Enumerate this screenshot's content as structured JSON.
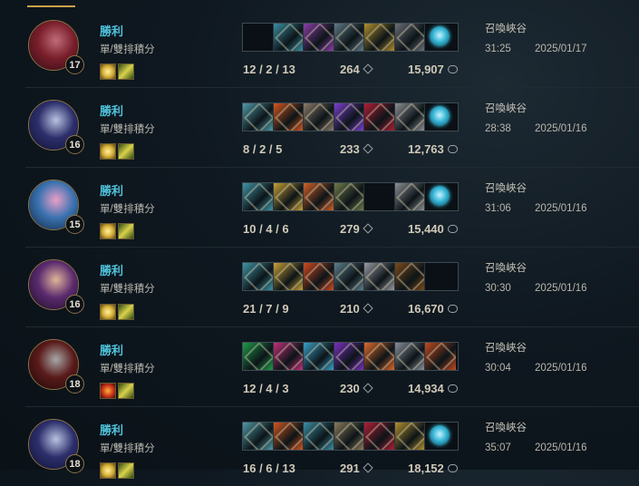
{
  "matches": [
    {
      "champion": "xayah",
      "level": "17",
      "result": "勝利",
      "queue": "單/雙排積分",
      "kda": "12 / 2 / 13",
      "cs": "264",
      "gold": "15,907",
      "map": "召喚峽谷",
      "duration": "31:25",
      "date": "2025/01/17",
      "portrait_colors": [
        "#7a1f2b",
        "#c06b7a",
        "#2a0c14"
      ],
      "spell_icons": [
        "flash-icon",
        "haste-icon"
      ],
      "items": [
        null,
        "#3a8fa3",
        "#8a3fa6",
        "#5f7a86",
        "#b08f2e",
        "#6b6f77",
        "ward-icon"
      ]
    },
    {
      "champion": "aatrox",
      "level": "16",
      "result": "勝利",
      "queue": "單/雙排積分",
      "kda": "8 / 2 / 5",
      "cs": "233",
      "gold": "12,763",
      "map": "召喚峽谷",
      "duration": "28:38",
      "date": "2025/01/16",
      "portrait_colors": [
        "#2c2f6b",
        "#b9c2e0",
        "#0e1030"
      ],
      "spell_icons": [
        "flash-icon",
        "haste-icon"
      ],
      "items": [
        "#4f9aa8",
        "#d0561f",
        "#8a7a6a",
        "#7a3fd0",
        "#b01e36",
        "#8c8f94",
        "ward-icon"
      ]
    },
    {
      "champion": "jinx",
      "level": "15",
      "result": "勝利",
      "queue": "單/雙排積分",
      "kda": "10 / 4 / 6",
      "cs": "279",
      "gold": "15,440",
      "map": "召喚峽谷",
      "duration": "31:06",
      "date": "2025/01/16",
      "portrait_colors": [
        "#3a72b0",
        "#e9a0c8",
        "#10243f"
      ],
      "spell_icons": [
        "flash-icon",
        "haste-icon"
      ],
      "items": [
        "#3f95a6",
        "#c8a036",
        "#d0602a",
        "#6e7a4a",
        null,
        "#8c8f94",
        "ward-icon"
      ]
    },
    {
      "champion": "akali",
      "level": "16",
      "result": "勝利",
      "queue": "單/雙排積分",
      "kda": "21 / 7 / 9",
      "cs": "210",
      "gold": "16,670",
      "map": "召喚峽谷",
      "duration": "30:30",
      "date": "2025/01/16",
      "portrait_colors": [
        "#5a2a6e",
        "#e0b49a",
        "#1a0c22"
      ],
      "spell_icons": [
        "flash-icon",
        "haste-icon"
      ],
      "items": [
        "#3f95a6",
        "#c8a036",
        "#cf4a22",
        "#5e7f8c",
        "#9a9aa3",
        "#7a4a1a",
        null
      ]
    },
    {
      "champion": "mordekaiser",
      "level": "18",
      "result": "勝利",
      "queue": "單/雙排積分",
      "kda": "12 / 4 / 3",
      "cs": "230",
      "gold": "14,934",
      "map": "召喚峽谷",
      "duration": "30:04",
      "date": "2025/01/16",
      "portrait_colors": [
        "#5a1a1a",
        "#a7a7a7",
        "#1a0808"
      ],
      "spell_icons": [
        "ignite-icon",
        "haste-icon"
      ],
      "items": [
        "#1f9a4a",
        "#c0307a",
        "#3aa0c8",
        "#7a30c0",
        "#e06a2a",
        "#8a8f9a",
        "#c04a20"
      ]
    },
    {
      "champion": "aatrox",
      "level": "18",
      "result": "勝利",
      "queue": "單/雙排積分",
      "kda": "16 / 6 / 13",
      "cs": "291",
      "gold": "18,152",
      "map": "召喚峽谷",
      "duration": "35:07",
      "date": "2025/01/16",
      "portrait_colors": [
        "#2c2f6b",
        "#b9c2e0",
        "#0e1030"
      ],
      "spell_icons": [
        "flash-icon",
        "haste-icon"
      ],
      "items": [
        "#4f9aa8",
        "#d0561f",
        "#3a8fa3",
        "#8a7a5a",
        "#b01e36",
        "#b08f2e",
        "ward-icon"
      ]
    }
  ]
}
